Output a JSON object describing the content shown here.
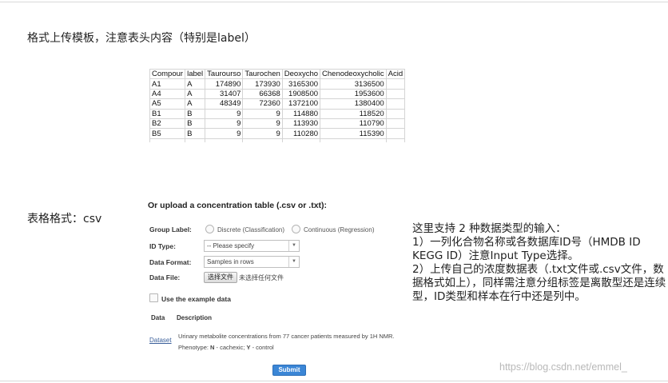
{
  "section1": {
    "heading": "格式上传模板，注意表头内容（特别是label）"
  },
  "sheet": {
    "headers": [
      "Compour",
      "label",
      "Taurourso",
      "Taurochen",
      "Deoxycho",
      "Chenodeoxycholic",
      "Acid",
      ""
    ],
    "rows": [
      [
        "A1",
        "A",
        "174890",
        "173930",
        "3165300",
        "3136500",
        "",
        ""
      ],
      [
        "A4",
        "A",
        "31407",
        "66368",
        "1908500",
        "1953600",
        "",
        ""
      ],
      [
        "A5",
        "A",
        "48349",
        "72360",
        "1372100",
        "1380400",
        "",
        ""
      ],
      [
        "B1",
        "B",
        "9",
        "9",
        "114880",
        "118520",
        "",
        ""
      ],
      [
        "B2",
        "B",
        "9",
        "9",
        "113930",
        "110790",
        "",
        ""
      ],
      [
        "B5",
        "B",
        "9",
        "9",
        "110280",
        "115390",
        "",
        ""
      ],
      [
        "",
        "",
        "",
        "",
        "",
        "",
        "",
        ""
      ]
    ]
  },
  "section2": {
    "heading": "表格格式：csv"
  },
  "form": {
    "title": "Or upload a concentration table (.csv or .txt):",
    "group_label": "Group Label:",
    "radio_discrete": "Discrete (Classification)",
    "radio_continuous": "Continuous (Regression)",
    "id_type_label": "ID Type:",
    "id_type_value": "-- Please specify",
    "data_format_label": "Data Format:",
    "data_format_value": "Samples in rows",
    "data_file_label": "Data File:",
    "file_button": "选择文件",
    "file_status": "未选择任何文件",
    "example_label": "Use the example data",
    "col_data": "Data",
    "col_description": "Description",
    "dataset_link": "Dataset",
    "desc_line1": "Urinary metabolite concentrations from 77 cancer patients measured by 1H NMR.",
    "desc_line2_prefix": "Phenotype: ",
    "desc_line2_n": "N",
    "desc_line2_mid": " - cachexic; ",
    "desc_line2_y": "Y",
    "desc_line2_suffix": " - control",
    "submit": "Submit"
  },
  "note": {
    "line1": "这里支持 2 种数据类型的输入：",
    "line2": "1）一列化合物名称或各数据库ID号（HMDB ID KEGG ID）注意Input Type选择。",
    "line3": "2）上传自己的浓度数据表（.txt文件或.csv文件，数据格式如上），同样需注意分组标签是离散型还是连续型，ID类型和样本在行中还是列中。"
  },
  "watermark": "https://blog.csdn.net/emmel_",
  "icons": {
    "select_arrow": "chevron-down-icon"
  },
  "colors": {
    "submit": "#3b86d6",
    "link": "#3a5f9a"
  }
}
